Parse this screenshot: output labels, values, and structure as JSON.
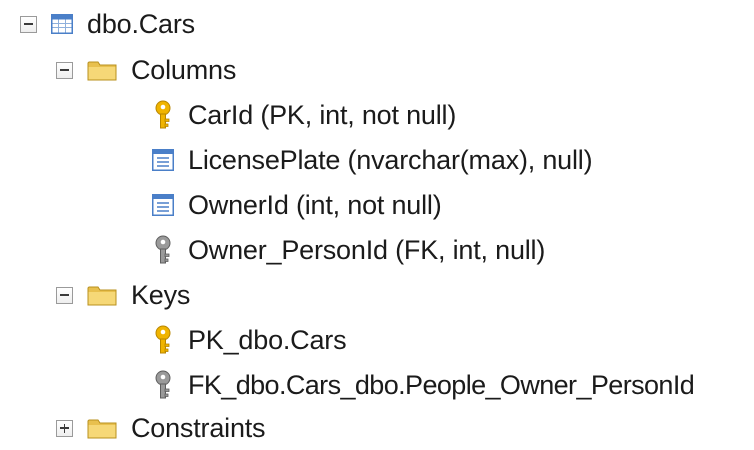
{
  "tree": {
    "table": {
      "label": "dbo.Cars",
      "icon": "table-icon",
      "expanded": true
    },
    "columns_folder": {
      "label": "Columns",
      "icon": "folder-icon",
      "expanded": true,
      "items": [
        {
          "label": "CarId (PK, int, not null)",
          "icon": "primary-key-icon"
        },
        {
          "label": "LicensePlate (nvarchar(max), null)",
          "icon": "column-icon"
        },
        {
          "label": "OwnerId (int, not null)",
          "icon": "column-icon"
        },
        {
          "label": "Owner_PersonId (FK, int, null)",
          "icon": "foreign-key-icon"
        }
      ]
    },
    "keys_folder": {
      "label": "Keys",
      "icon": "folder-icon",
      "expanded": true,
      "items": [
        {
          "label": "PK_dbo.Cars",
          "icon": "primary-key-icon"
        },
        {
          "label": "FK_dbo.Cars_dbo.People_Owner_PersonId",
          "icon": "foreign-key-icon"
        }
      ]
    },
    "constraints_folder": {
      "label": "Constraints",
      "icon": "folder-icon",
      "expanded": false
    }
  },
  "colors": {
    "primary_key": "#f0b400",
    "foreign_key": "#8c8c8c",
    "folder": "#e8c04e",
    "table_header": "#4a7fc8"
  }
}
